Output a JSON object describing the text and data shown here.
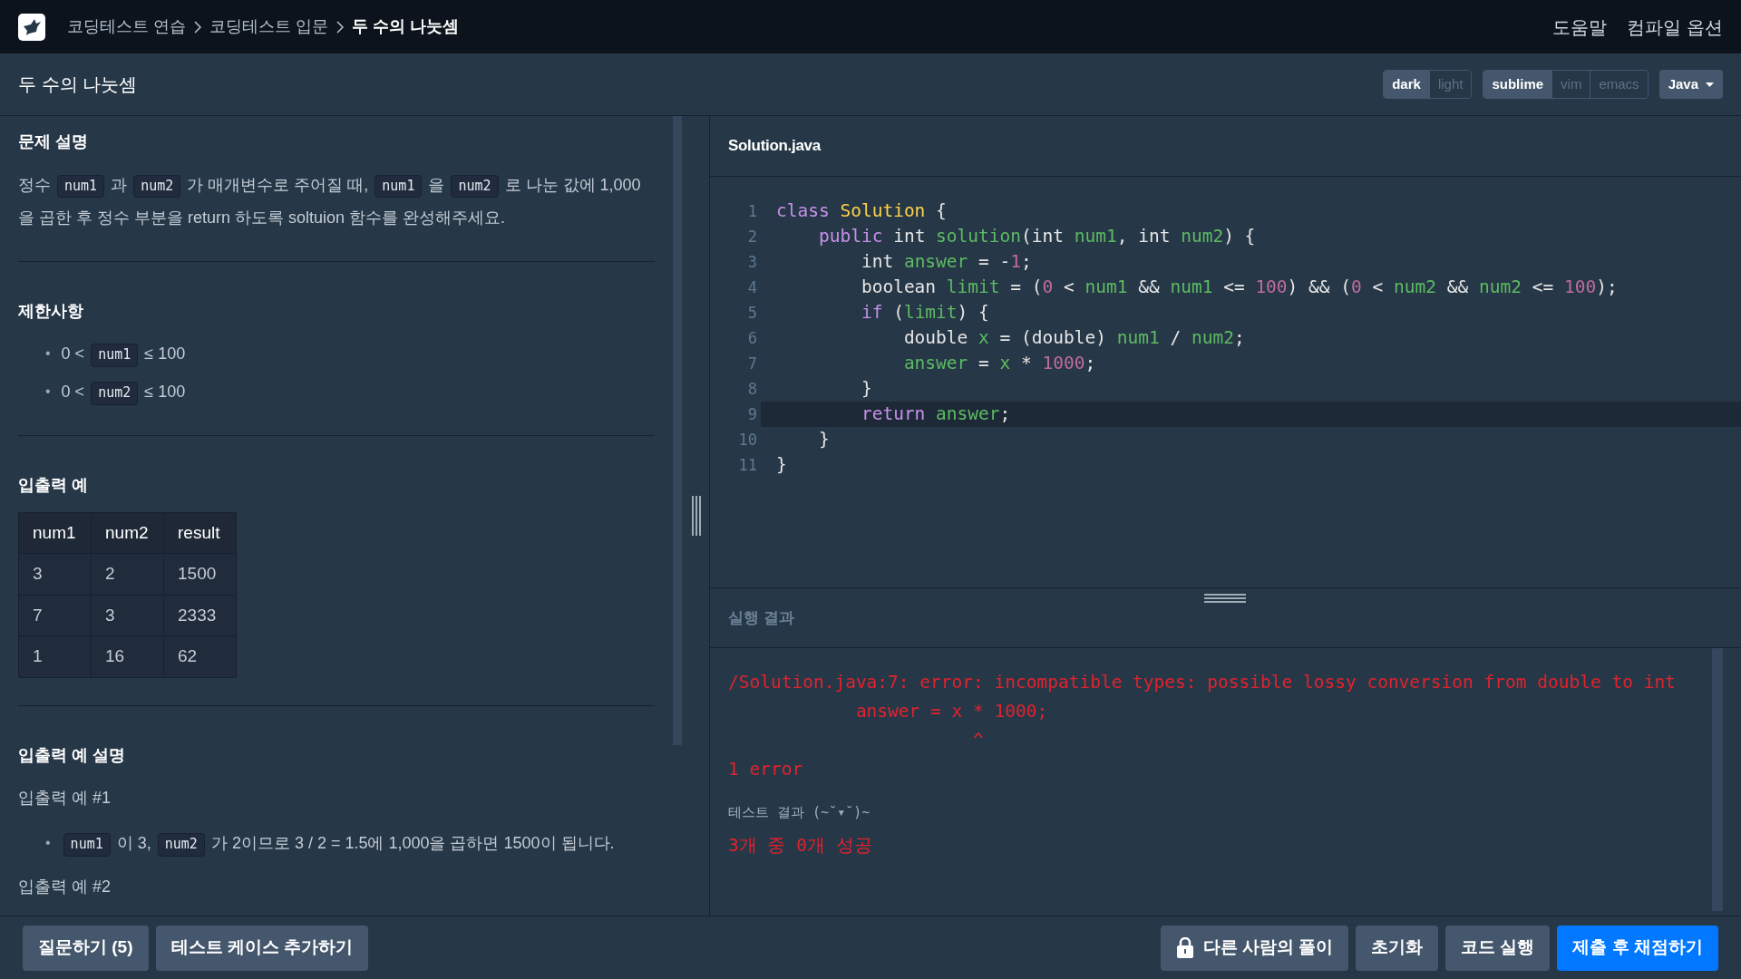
{
  "navbar": {
    "breadcrumbs": [
      {
        "label": "코딩테스트 연습",
        "current": false
      },
      {
        "label": "코딩테스트 입문",
        "current": false
      },
      {
        "label": "두 수의 나눗셈",
        "current": true
      }
    ],
    "links": [
      "도움말",
      "컴파일 옵션"
    ]
  },
  "title_bar": {
    "title": "두 수의 나눗셈",
    "theme_toggle": [
      {
        "label": "dark",
        "selected": true
      },
      {
        "label": "light",
        "selected": false
      }
    ],
    "keymap_toggle": [
      {
        "label": "sublime",
        "selected": true
      },
      {
        "label": "vim",
        "selected": false
      },
      {
        "label": "emacs",
        "selected": false
      }
    ],
    "language": "Java"
  },
  "problem": {
    "sections": [
      {
        "heading": "문제 설명",
        "blocks": [
          {
            "kind": "paragraph",
            "segments": [
              {
                "kind": "text",
                "text": "정수 "
              },
              {
                "kind": "code",
                "text": "num1"
              },
              {
                "kind": "text",
                "text": " 과 "
              },
              {
                "kind": "code",
                "text": "num2"
              },
              {
                "kind": "text",
                "text": " 가 매개변수로 주어질 때, "
              },
              {
                "kind": "code",
                "text": "num1"
              },
              {
                "kind": "text",
                "text": " 을 "
              },
              {
                "kind": "code",
                "text": "num2"
              },
              {
                "kind": "text",
                "text": " 로 나눈 값에 1,000을 곱한 후 정수 부분을 return 하도록 soltuion 함수를 완성해주세요."
              }
            ]
          }
        ]
      },
      {
        "heading": "제한사항",
        "blocks": [
          {
            "kind": "bullets",
            "marker": "•",
            "items": [
              [
                {
                  "kind": "text",
                  "text": "0 < "
                },
                {
                  "kind": "code",
                  "text": "num1"
                },
                {
                  "kind": "text",
                  "text": " ≤ 100"
                }
              ],
              [
                {
                  "kind": "text",
                  "text": "0 < "
                },
                {
                  "kind": "code",
                  "text": "num2"
                },
                {
                  "kind": "text",
                  "text": " ≤ 100"
                }
              ]
            ]
          }
        ]
      },
      {
        "heading": "입출력 예",
        "blocks": [
          {
            "kind": "table",
            "columns": [
              "num1",
              "num2",
              "result"
            ],
            "rows": [
              [
                "3",
                "2",
                "1500"
              ],
              [
                "7",
                "3",
                "2333"
              ],
              [
                "1",
                "16",
                "62"
              ]
            ]
          }
        ]
      },
      {
        "heading": "입출력 예 설명",
        "blocks": [
          {
            "kind": "paragraph",
            "segments": [
              {
                "kind": "text",
                "text": "입출력 예 #1"
              }
            ]
          },
          {
            "kind": "bullets",
            "marker": "•",
            "items": [
              [
                {
                  "kind": "code",
                  "text": "num1"
                },
                {
                  "kind": "text",
                  "text": " 이 3, "
                },
                {
                  "kind": "code",
                  "text": "num2"
                },
                {
                  "kind": "text",
                  "text": " 가 2이므로 3 / 2 = 1.5에 1,000을 곱하면 1500이 됩니다."
                }
              ]
            ]
          },
          {
            "kind": "paragraph",
            "segments": [
              {
                "kind": "text",
                "text": "입출력 예 #2"
              }
            ]
          }
        ]
      }
    ]
  },
  "editor": {
    "filename": "Solution.java",
    "lines": [
      {
        "number": "1",
        "active": false,
        "tokens": [
          {
            "kind": "kw",
            "text": "class"
          },
          {
            "kind": "cls",
            "text": " Solution"
          },
          {
            "kind": "plain",
            "text": " {"
          }
        ]
      },
      {
        "number": "2",
        "active": false,
        "tokens": [
          {
            "kind": "kw",
            "text": "    public"
          },
          {
            "kind": "plain",
            "text": " int "
          },
          {
            "kind": "var",
            "text": "solution"
          },
          {
            "kind": "plain",
            "text": "(int "
          },
          {
            "kind": "var",
            "text": "num1"
          },
          {
            "kind": "plain",
            "text": ", int "
          },
          {
            "kind": "var",
            "text": "num2"
          },
          {
            "kind": "plain",
            "text": ") {"
          }
        ]
      },
      {
        "number": "3",
        "active": false,
        "tokens": [
          {
            "kind": "plain",
            "text": "        int "
          },
          {
            "kind": "var",
            "text": "answer"
          },
          {
            "kind": "plain",
            "text": " = -"
          },
          {
            "kind": "num",
            "text": "1"
          },
          {
            "kind": "plain",
            "text": ";"
          }
        ]
      },
      {
        "number": "4",
        "active": false,
        "tokens": [
          {
            "kind": "plain",
            "text": "        boolean "
          },
          {
            "kind": "var",
            "text": "limit"
          },
          {
            "kind": "plain",
            "text": " = ("
          },
          {
            "kind": "num",
            "text": "0"
          },
          {
            "kind": "plain",
            "text": " < "
          },
          {
            "kind": "var",
            "text": "num1"
          },
          {
            "kind": "plain",
            "text": " && "
          },
          {
            "kind": "var",
            "text": "num1"
          },
          {
            "kind": "plain",
            "text": " <= "
          },
          {
            "kind": "num",
            "text": "100"
          },
          {
            "kind": "plain",
            "text": ") && ("
          },
          {
            "kind": "num",
            "text": "0"
          },
          {
            "kind": "plain",
            "text": " < "
          },
          {
            "kind": "var",
            "text": "num2"
          },
          {
            "kind": "plain",
            "text": " && "
          },
          {
            "kind": "var",
            "text": "num2"
          },
          {
            "kind": "plain",
            "text": " <= "
          },
          {
            "kind": "num",
            "text": "100"
          },
          {
            "kind": "plain",
            "text": ");"
          }
        ]
      },
      {
        "number": "5",
        "active": false,
        "tokens": [
          {
            "kind": "kw",
            "text": "        if"
          },
          {
            "kind": "plain",
            "text": " ("
          },
          {
            "kind": "var",
            "text": "limit"
          },
          {
            "kind": "plain",
            "text": ") {"
          }
        ]
      },
      {
        "number": "6",
        "active": false,
        "tokens": [
          {
            "kind": "plain",
            "text": "            double "
          },
          {
            "kind": "var",
            "text": "x"
          },
          {
            "kind": "plain",
            "text": " = (double) "
          },
          {
            "kind": "var",
            "text": "num1"
          },
          {
            "kind": "plain",
            "text": " / "
          },
          {
            "kind": "var",
            "text": "num2"
          },
          {
            "kind": "plain",
            "text": ";"
          }
        ]
      },
      {
        "number": "7",
        "active": false,
        "tokens": [
          {
            "kind": "var",
            "text": "            answer"
          },
          {
            "kind": "plain",
            "text": " = "
          },
          {
            "kind": "var",
            "text": "x"
          },
          {
            "kind": "plain",
            "text": " * "
          },
          {
            "kind": "num",
            "text": "1000"
          },
          {
            "kind": "plain",
            "text": ";"
          }
        ]
      },
      {
        "number": "8",
        "active": false,
        "tokens": [
          {
            "kind": "plain",
            "text": "        }"
          }
        ]
      },
      {
        "number": "9",
        "active": true,
        "tokens": [
          {
            "kind": "kw",
            "text": "        return"
          },
          {
            "kind": "var",
            "text": " answer"
          },
          {
            "kind": "plain",
            "text": ";"
          }
        ]
      },
      {
        "number": "10",
        "active": false,
        "tokens": [
          {
            "kind": "plain",
            "text": "    }"
          }
        ]
      },
      {
        "number": "11",
        "active": false,
        "tokens": [
          {
            "kind": "plain",
            "text": "}"
          }
        ]
      }
    ]
  },
  "result": {
    "title": "실행 결과",
    "lines": [
      {
        "kind": "error",
        "text": "/Solution.java:7: error: incompatible types: possible lossy conversion from double to int"
      },
      {
        "kind": "error",
        "text": "            answer = x * 1000;"
      },
      {
        "kind": "error",
        "text": "                       ^"
      },
      {
        "kind": "error",
        "text": "1 error"
      },
      {
        "kind": "info",
        "text": "테스트 결과 (~˘▾˘)~"
      },
      {
        "kind": "error",
        "text": "3개 중 0개 성공"
      }
    ]
  },
  "footer": {
    "left_buttons": [
      {
        "label": "질문하기 (5)",
        "kind": "secondary",
        "locked": false
      },
      {
        "label": "테스트 케이스 추가하기",
        "kind": "secondary",
        "locked": false
      }
    ],
    "right_buttons": [
      {
        "label": "다른 사람의 풀이",
        "kind": "secondary",
        "locked": true
      },
      {
        "label": "초기화",
        "kind": "secondary",
        "locked": false
      },
      {
        "label": "코드 실행",
        "kind": "secondary",
        "locked": false
      },
      {
        "label": "제출 후 채점하기",
        "kind": "primary",
        "locked": false
      }
    ]
  }
}
